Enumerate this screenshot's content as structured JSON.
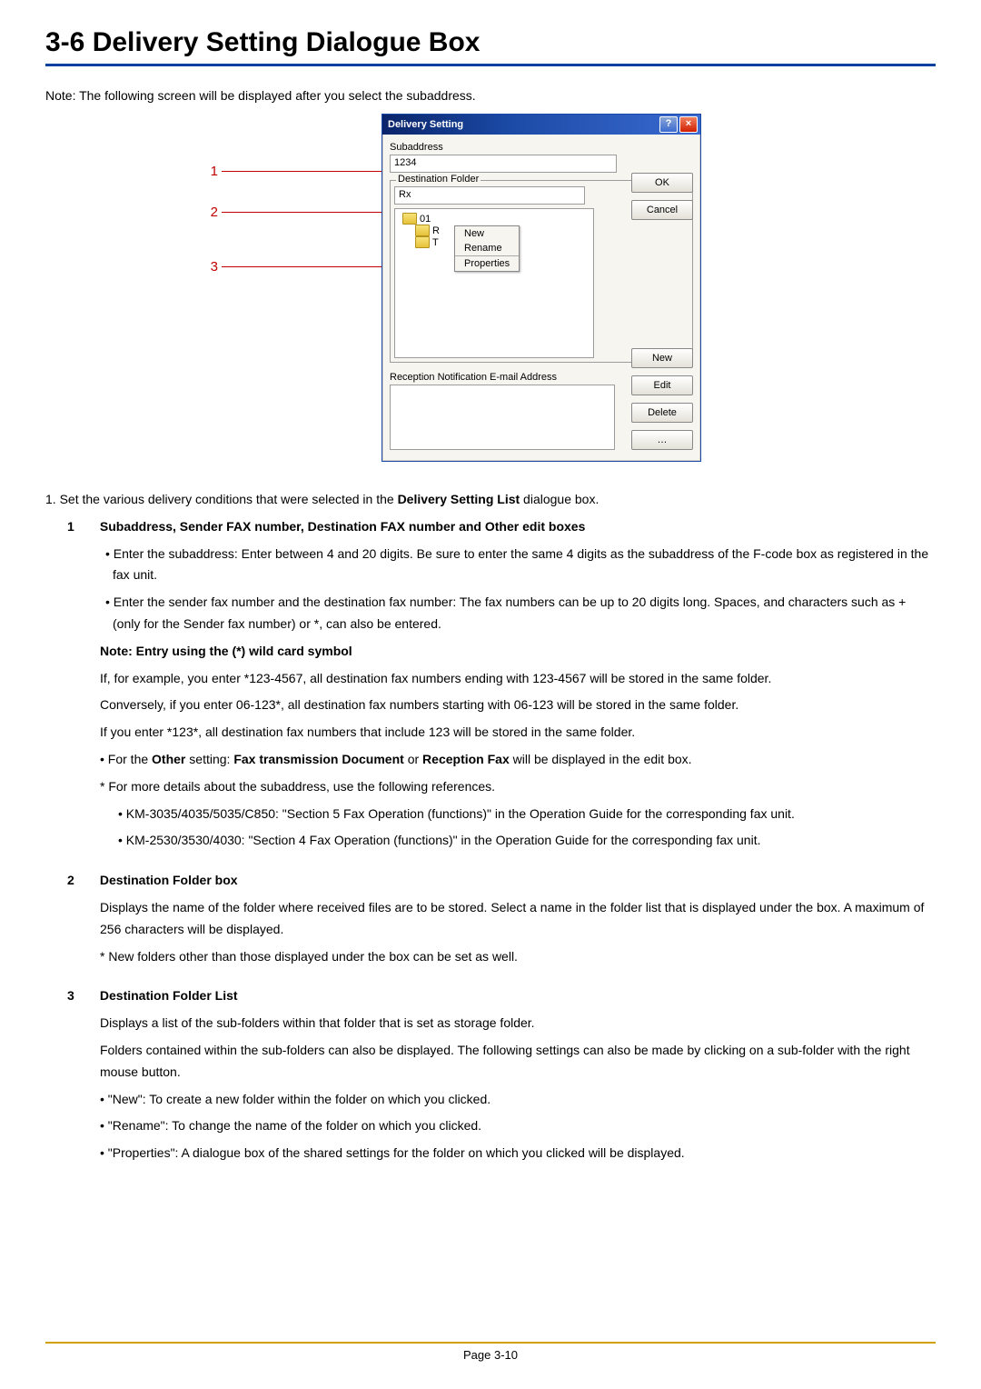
{
  "title": "3-6  Delivery Setting Dialogue Box",
  "intro": "Note: The following screen will be displayed after you select the subaddress.",
  "callouts": {
    "c1": "1",
    "c2": "2",
    "c3": "3"
  },
  "dialog": {
    "title": "Delivery Setting",
    "subaddress_label": "Subaddress",
    "subaddress_value": "1234",
    "destfolder_legend": "Destination Folder",
    "rx_value": "Rx",
    "tree_row1": "01",
    "tree_row2": "R",
    "tree_row3": "T",
    "context": {
      "new": "New",
      "rename": "Rename",
      "properties": "Properties"
    },
    "ok": "OK",
    "cancel": "Cancel",
    "emails_label": "Reception Notification E-mail Address",
    "new": "New",
    "edit": "Edit",
    "delete": "Delete",
    "more": "…"
  },
  "body": {
    "intro": "1. Set the various delivery conditions that were selected in the ",
    "intro_b": "Delivery Setting List",
    "intro_tail": " dialogue box.",
    "s1_num": "1",
    "s1_head_b1": "Subaddress, Sender FAX number, Destination FAX number",
    "s1_head_mid": " and ",
    "s1_head_b2": "Other",
    "s1_head_tail": " edit boxes",
    "s1_p1": "Enter the subaddress: Enter between 4 and 20 digits. Be sure to enter the same 4 digits as the subaddress of the F-code box as registered in the fax unit.",
    "s1_p2": "Enter the sender fax number and the destination fax number: The fax numbers can be up to 20 digits long. Spaces, and characters such as + (only for the Sender fax number) or *, can also be entered.",
    "s1_note_head": "Note: Entry using the (*) wild card symbol",
    "s1_note_p1": "If, for example, you enter *123-4567, all destination fax numbers ending with 123-4567 will be stored in the same folder.",
    "s1_note_p2": "Conversely, if you enter 06-123*, all destination fax numbers starting with 06-123 will be stored in the same folder.",
    "s1_note_p3": "If you enter *123*, all destination fax numbers that include 123 will be stored in the same folder.",
    "s1_other_pre": "For the ",
    "s1_other_b1": "Other",
    "s1_other_mid": " setting: ",
    "s1_other_b2": "Fax transmission Document",
    "s1_other_mid2": " or ",
    "s1_other_b3": "Reception Fax",
    "s1_other_tail": " will be displayed in the edit box.",
    "s1_ast": "For more details about the subaddress, use the following references.",
    "s1_ref1": "KM-3035/4035/5035/C850: \"Section 5  Fax Operation (functions)\" in the Operation Guide for the corresponding fax unit.",
    "s1_ref2": "KM-2530/3530/4030: \"Section 4  Fax Operation (functions)\" in the Operation Guide for the corresponding fax unit.",
    "s2_num": "2",
    "s2_head_b": "Destination Folder",
    "s2_head_tail": " box",
    "s2_p1": "Displays the name of the folder where received files are to be stored. Select a name in the folder list that is displayed under the box. A maximum of 256 characters will be displayed.",
    "s2_ast": "New folders other than those displayed under the box can be set as well.",
    "s3_num": "3",
    "s3_head_b": "Destination Folder",
    "s3_head_tail": " List",
    "s3_p1": "Displays a list of the sub-folders within that folder that is set as storage folder.",
    "s3_p2": "Folders contained within the sub-folders can also be displayed. The following settings can also be made by clicking on a sub-folder with the right mouse button.",
    "s3_b1": "\"New\": To create a new folder within the folder on which you clicked.",
    "s3_b2": "\"Rename\": To change the name of the folder on which you clicked.",
    "s3_b3": "\"Properties\": A dialogue box of the shared settings for the folder on which you clicked will be displayed."
  },
  "footer": "Page 3-10"
}
